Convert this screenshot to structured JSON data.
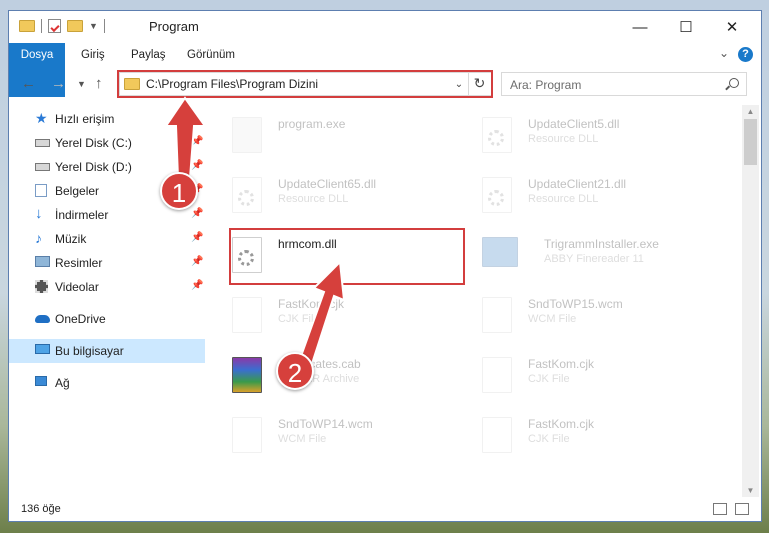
{
  "window": {
    "title": "Program",
    "controls": {
      "minimize": "—",
      "maximize": "☐",
      "close": "✕"
    }
  },
  "ribbon": {
    "tabs": [
      {
        "label": "Dosya"
      },
      {
        "label": "Giriş"
      },
      {
        "label": "Paylaş"
      },
      {
        "label": "Görünüm"
      }
    ],
    "help": "?"
  },
  "address": {
    "path": "C:\\Program Files\\Program Dizini",
    "search_placeholder": "Ara: Program"
  },
  "sidebar": {
    "items": [
      {
        "label": "Hızlı erişim",
        "icon": "star-icon",
        "pinned": false
      },
      {
        "label": "Yerel Disk (C:)",
        "icon": "drive-icon",
        "pinned": true
      },
      {
        "label": "Yerel Disk (D:)",
        "icon": "drive-icon",
        "pinned": true
      },
      {
        "label": "Belgeler",
        "icon": "documents-icon",
        "pinned": true
      },
      {
        "label": "İndirmeler",
        "icon": "download-icon",
        "pinned": true
      },
      {
        "label": "Müzik",
        "icon": "music-icon",
        "pinned": true
      },
      {
        "label": "Resimler",
        "icon": "pictures-icon",
        "pinned": true
      },
      {
        "label": "Videolar",
        "icon": "video-icon",
        "pinned": true
      },
      {
        "label": "OneDrive",
        "icon": "cloud-icon",
        "pinned": false
      },
      {
        "label": "Bu bilgisayar",
        "icon": "computer-icon",
        "pinned": false,
        "selected": true
      },
      {
        "label": "Ağ",
        "icon": "network-icon",
        "pinned": false
      }
    ]
  },
  "files": [
    {
      "name": "program.exe",
      "type": "",
      "highlight": false
    },
    {
      "name": "UpdateClient5.dll",
      "type": "Resource DLL",
      "highlight": false
    },
    {
      "name": "UpdateClient65.dll",
      "type": "Resource DLL",
      "highlight": false
    },
    {
      "name": "UpdateClient21.dll",
      "type": "Resource DLL",
      "highlight": false
    },
    {
      "name": "hrmcom.dll",
      "type": "",
      "highlight": true
    },
    {
      "name": "TrigrammInstaller.exe",
      "type": "ABBY Finereader 11",
      "highlight": false
    },
    {
      "name": "FastKom.cjk",
      "type": "CJK File",
      "highlight": false
    },
    {
      "name": "SndToWP15.wcm",
      "type": "WCM File",
      "highlight": false
    },
    {
      "name": "Certificates.cab",
      "type": "WinRAR Archive",
      "highlight": false
    },
    {
      "name": "FastKom.cjk",
      "type": "CJK File",
      "highlight": false
    },
    {
      "name": "SndToWP14.wcm",
      "type": "WCM File",
      "highlight": false
    },
    {
      "name": "FastKom.cjk",
      "type": "CJK File",
      "highlight": false
    }
  ],
  "status": {
    "count_text": "136 öğe"
  },
  "annotations": {
    "step1": "1",
    "step2": "2",
    "color": "#d6403c"
  }
}
